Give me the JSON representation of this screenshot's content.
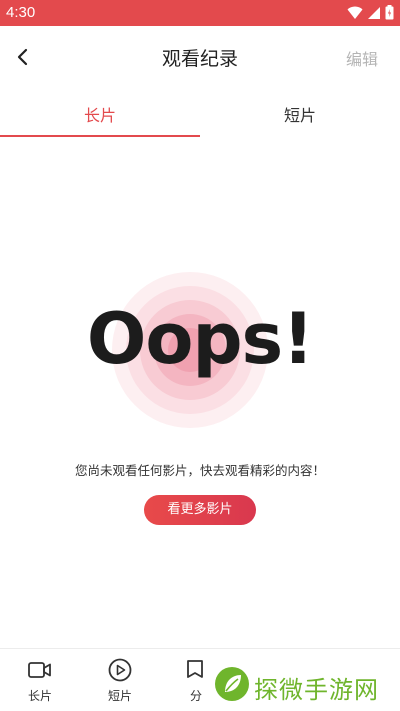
{
  "status_bar": {
    "time": "4:30",
    "background_color": "#e34a4d",
    "icons": [
      "wifi-icon",
      "signal-icon",
      "battery-icon"
    ]
  },
  "header": {
    "title": "观看纪录",
    "edit_label": "编辑",
    "back_icon": "chevron-left-icon"
  },
  "tabs": [
    {
      "label": "长片",
      "active": true
    },
    {
      "label": "短片",
      "active": false
    }
  ],
  "accent_color": "#e34a4d",
  "empty_state": {
    "oops_text": "Oops!",
    "message": "您尚未观看任何影片，快去观看精彩的内容！",
    "button_label": "看更多影片"
  },
  "bottom_nav": {
    "items": [
      {
        "label": "长片",
        "icon": "video-camera-icon"
      },
      {
        "label": "短片",
        "icon": "play-circle-icon"
      },
      {
        "label": "分",
        "icon": "tag-icon"
      }
    ]
  },
  "watermark": {
    "text": "探微手游网",
    "color": "#6fb52c"
  }
}
